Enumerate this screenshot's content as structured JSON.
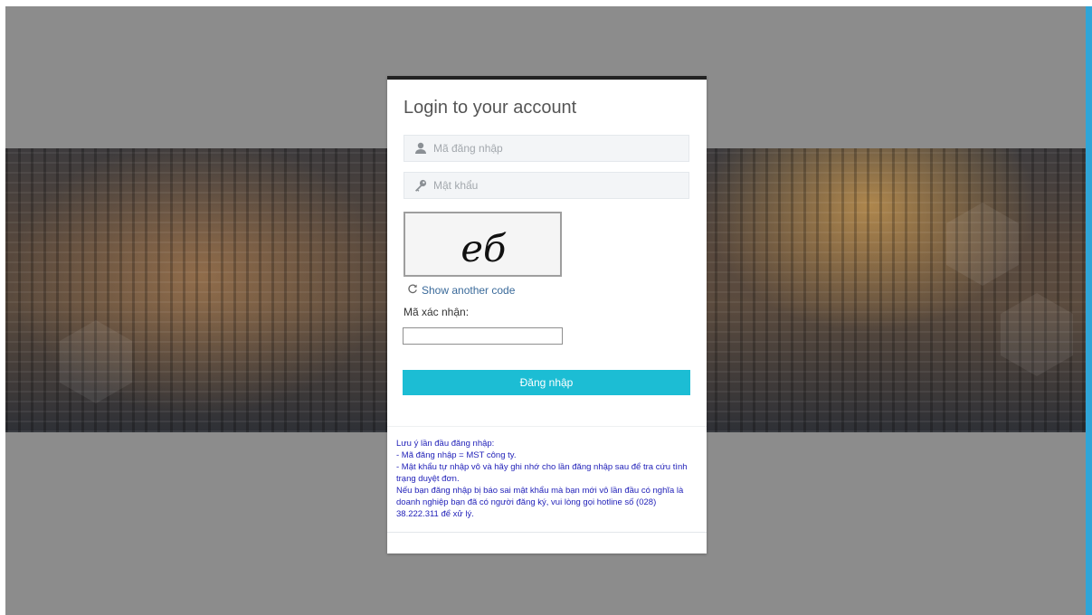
{
  "login": {
    "title": "Login to your account",
    "username_placeholder": "Mã đăng nhập",
    "password_placeholder": "Mật khẩu",
    "captcha_text": "eб",
    "refresh_label": "Show another code",
    "code_label": "Mã xác nhận:",
    "code_value": "",
    "submit_label": "Đăng nhập"
  },
  "notice": {
    "lines": [
      "Lưu ý lần đầu đăng nhập:",
      "- Mã đăng nhập = MST công ty.",
      "- Mật khẩu tự nhập vô và hãy ghi nhớ cho lần đăng nhập sau để tra cứu tình trạng duyệt đơn.",
      "Nếu bạn đăng nhập bị báo sai mật khẩu mà bạn mới vô lần đầu có nghĩa là doanh nghiệp bạn đã có người đăng ký, vui lòng gọi hotline số (028) 38.222.311 để xử lý."
    ]
  },
  "colors": {
    "accent": "#1cbdd4",
    "notice_text": "#1f1fb8",
    "card_top_border": "#222222",
    "side_bar": "#2fa5d8"
  },
  "icons": [
    "user-icon",
    "key-icon",
    "refresh-icon"
  ]
}
